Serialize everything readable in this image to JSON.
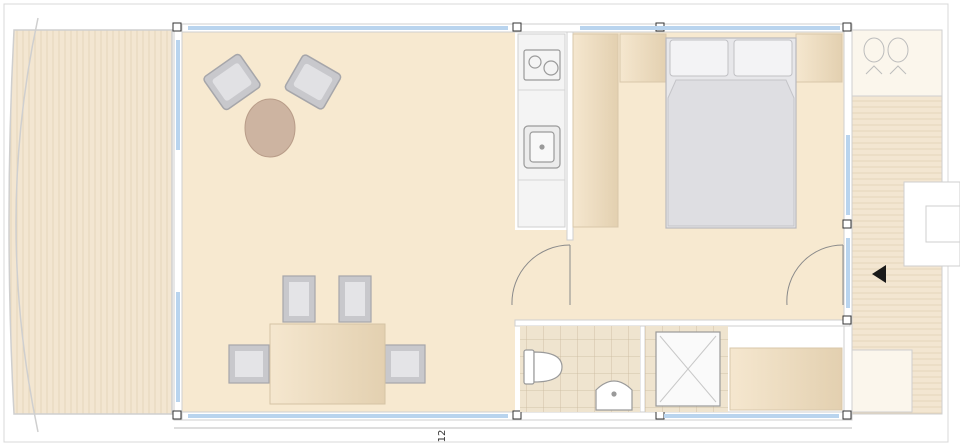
{
  "plan": {
    "dimension_label": "12",
    "colors": {
      "floor": "#f7e9d0",
      "wall": "#ffffff",
      "wall_line": "#cfcfcf",
      "window": "#b9d4ee",
      "deck": "#f3e6d1",
      "deck_slat": "#e6d6bb",
      "furniture_gray": "#c8c8cc",
      "table": "#e9dcc6",
      "round_table": "#cdb4a1",
      "tile": "#efe4cf",
      "tile_line": "#c9b99d",
      "counter": "#f4f4f4",
      "bed": "#dedee2",
      "arrow": "#1a1a1a"
    },
    "icons": [
      "lounge-chair-icon",
      "round-table-icon",
      "dining-chair-icon",
      "dining-table-icon",
      "sink-icon",
      "cooktop-icon",
      "bed-icon",
      "pillow-icon",
      "toilet-icon",
      "washbasin-icon",
      "shower-icon",
      "door-swing-icon",
      "entrance-arrow-icon"
    ]
  }
}
